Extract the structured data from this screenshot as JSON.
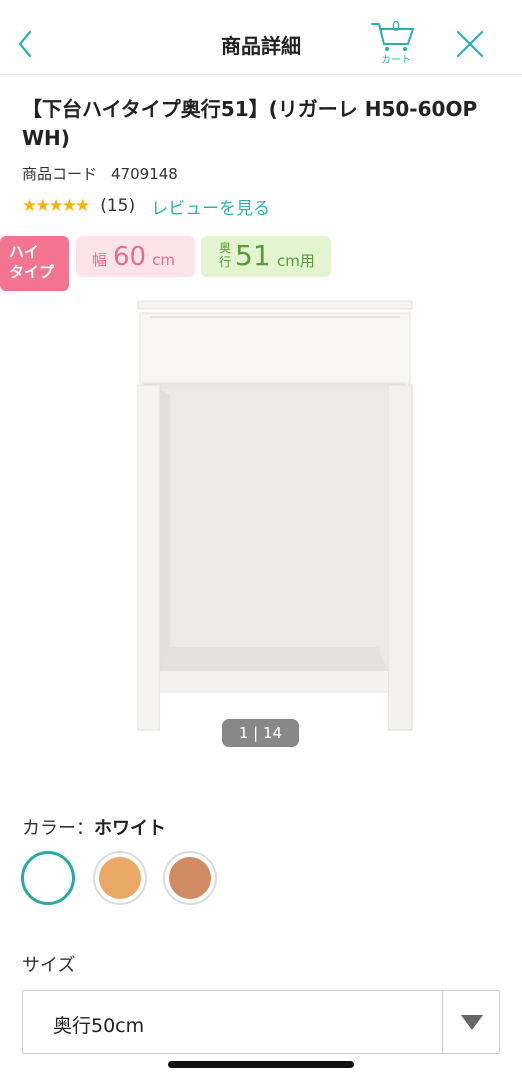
{
  "header": {
    "title": "商品詳細",
    "cart_count": "0",
    "cart_label": "カート"
  },
  "product": {
    "title": "【下台ハイタイプ奥行51】(リガーレ H50-60OP WH)",
    "code_label": "商品コード",
    "code_value": "4709148",
    "rating": 5,
    "stars": "★★★★★",
    "review_count": "(15)",
    "review_link": "レビューを見る"
  },
  "badges": {
    "type_label": "ハイ\nタイプ",
    "width_label": "幅",
    "width_value": "60",
    "width_unit": "cm",
    "depth_label": "奥行",
    "depth_value": "51",
    "depth_unit": "cm用"
  },
  "gallery": {
    "indicator": "1 | 14"
  },
  "color": {
    "label": "カラー：",
    "selected": "ホワイト",
    "swatches": [
      "#ffffff",
      "#e9a866",
      "#d08b62"
    ]
  },
  "size": {
    "label": "サイズ",
    "value": "奥行50cm"
  },
  "colors": {
    "accent": "#2bb2b0",
    "star": "#f2b705",
    "badge_pink": "#f27490",
    "badge_width_bg": "#fde4ea",
    "badge_depth_bg": "#e2f4d0"
  },
  "icons": [
    "chevron-left-icon",
    "cart-icon",
    "close-icon",
    "chevron-down-icon"
  ]
}
